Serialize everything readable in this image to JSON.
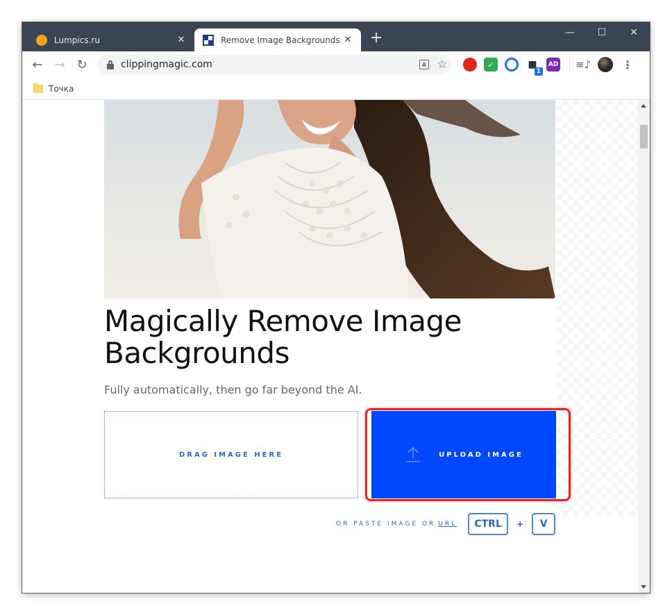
{
  "tabs": [
    {
      "title": "Lumpics.ru",
      "active": false
    },
    {
      "title": "Remove Image Backgrounds Onl",
      "active": true
    }
  ],
  "tab_close_glyph": "✕",
  "new_tab_glyph": "+",
  "window_controls": {
    "minimize": "—",
    "maximize": "☐",
    "close": "✕"
  },
  "toolbar": {
    "back_glyph": "←",
    "forward_glyph": "→",
    "reload_glyph": "↻",
    "url": "clippingmagic.com",
    "translate_glyph": "A",
    "star_glyph": "☆",
    "ext_badge": "1",
    "ext_purple_text": "AD",
    "media_glyph": "≡♪",
    "menu_glyph": "⋮"
  },
  "bookmarks": [
    {
      "label": "Точка"
    }
  ],
  "page": {
    "headline": "Magically Remove Image Backgrounds",
    "subtitle": "Fully automatically, then go far beyond the AI.",
    "drop_label": "DRAG IMAGE HERE",
    "upload_label": "UPLOAD IMAGE",
    "paste_text": "OR PASTE IMAGE OR",
    "paste_url": "URL",
    "key_ctrl": "CTRL",
    "plus": "+",
    "key_v": "V"
  },
  "colors": {
    "tabstrip": "#3b4453",
    "upload_button": "#0047ff",
    "highlight": "#e0262a",
    "accent_text": "#2a66c8"
  }
}
